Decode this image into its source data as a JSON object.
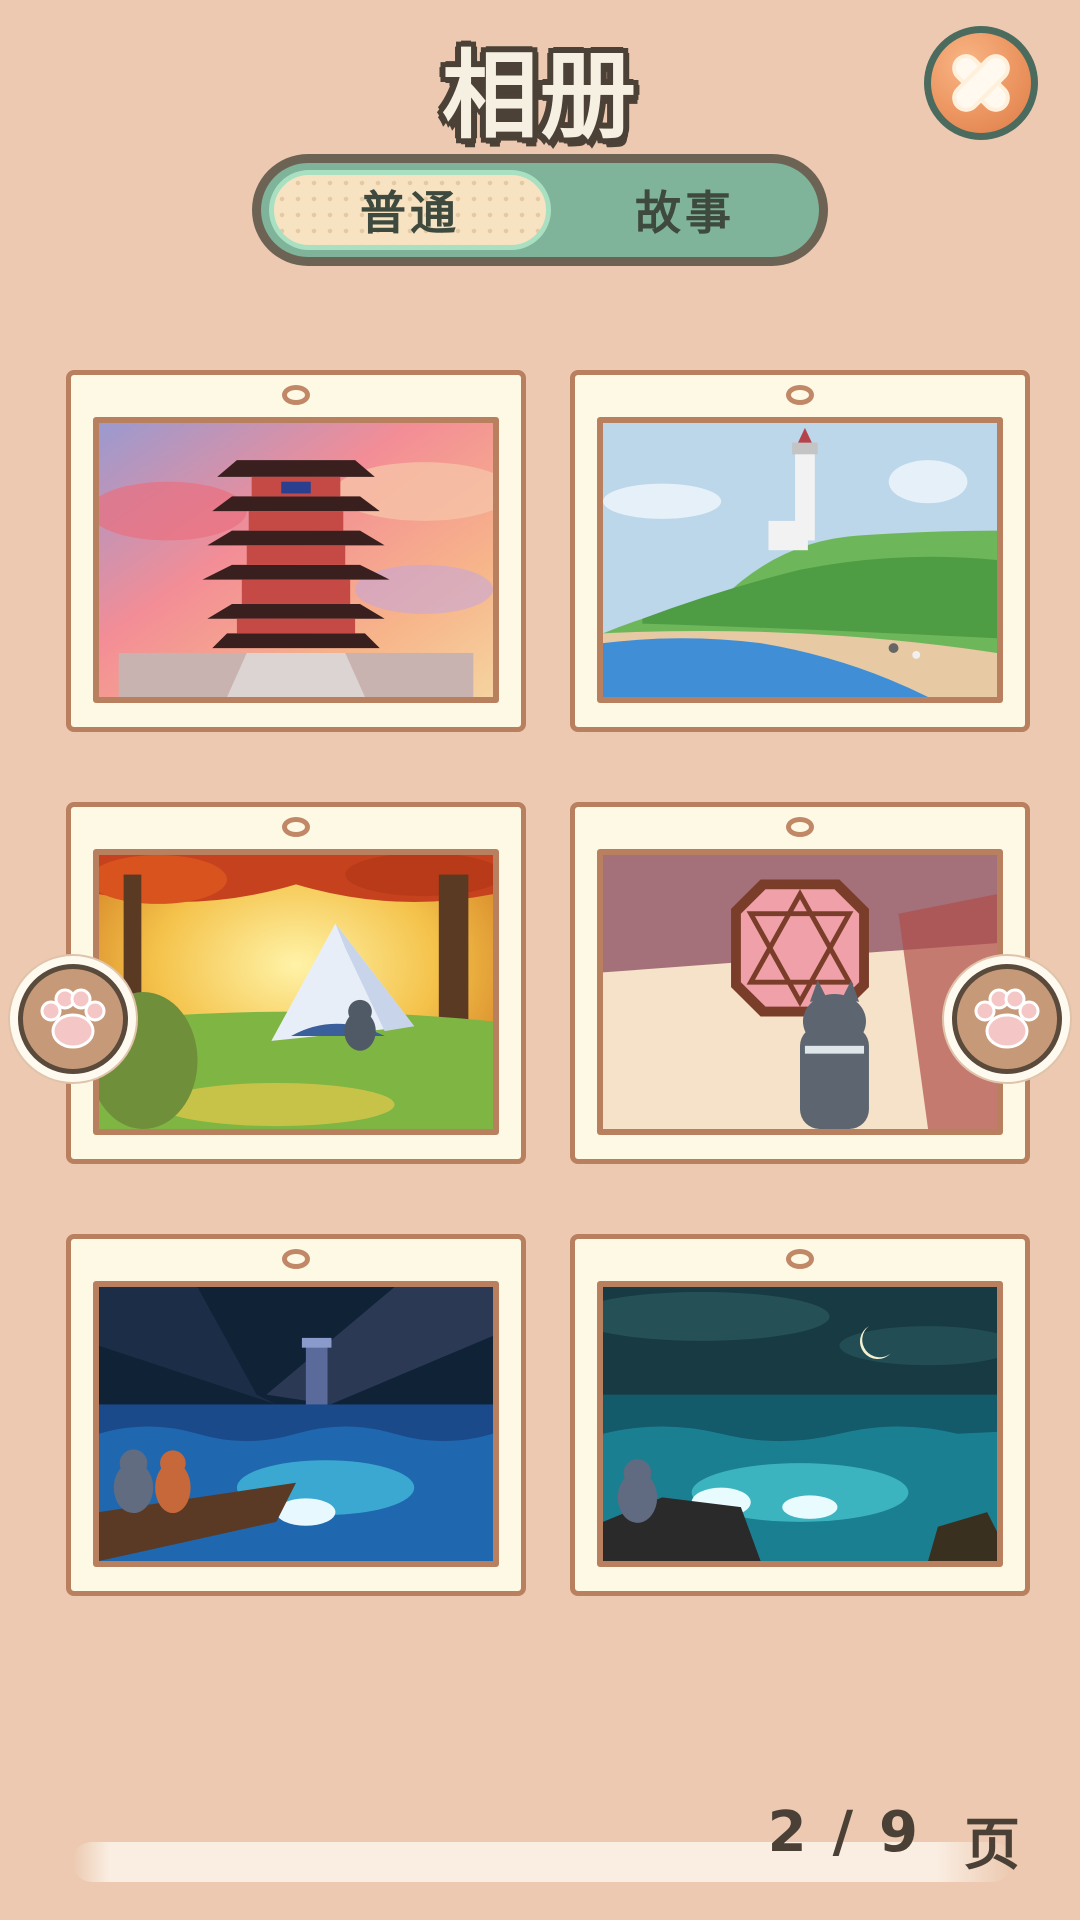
{
  "header": {
    "title": "相册",
    "close_icon": "close-icon"
  },
  "tabs": [
    {
      "label": "普通",
      "selected": true
    },
    {
      "label": "故事",
      "selected": false
    }
  ],
  "photos": [
    {
      "scene": "red pagoda tower at sunset"
    },
    {
      "scene": "white lighthouse on green hill above blue bay"
    },
    {
      "scene": "white tent under autumn trees with cat"
    },
    {
      "scene": "octagonal lattice window with cat"
    },
    {
      "scene": "two cats on pier under lighthouse at night sea"
    },
    {
      "scene": "cat on rocks by moonlit glowing sea"
    }
  ],
  "navigation": {
    "prev_icon": "paw-prev-icon",
    "next_icon": "paw-next-icon"
  },
  "pagination": {
    "current": "2",
    "separator": "/",
    "total": "9",
    "unit": "页"
  },
  "colors": {
    "background": "#ecc9b0",
    "card": "#fef9e4",
    "card_border": "#b9805f",
    "tab_track": "#7fb39a",
    "tab_selected": "#f7e2c2",
    "close_button": "#ec9560"
  }
}
